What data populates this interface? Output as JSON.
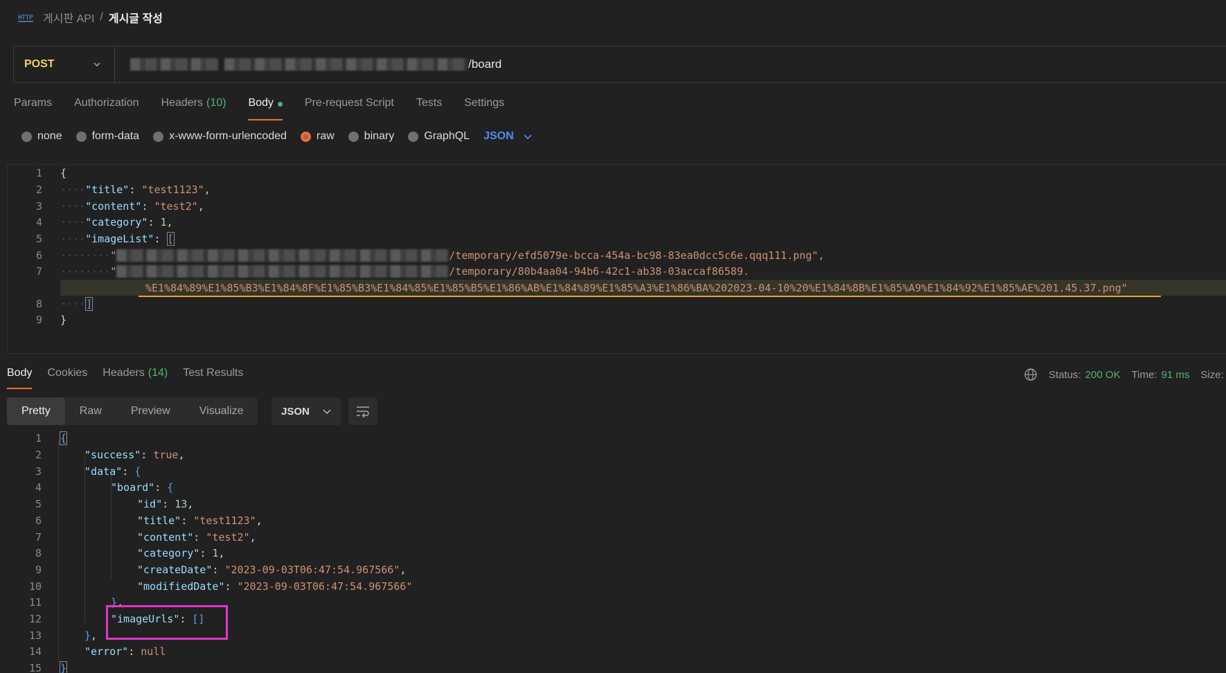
{
  "breadcrumb": {
    "parent": "게시판 API",
    "separator": "/",
    "current": "게시글 작성",
    "icon": "http-icon"
  },
  "request": {
    "method": "POST",
    "url_suffix": "/board"
  },
  "request_tabs": [
    {
      "label": "Params"
    },
    {
      "label": "Authorization"
    },
    {
      "label": "Headers",
      "count": "(10)"
    },
    {
      "label": "Body"
    },
    {
      "label": "Pre-request Script"
    },
    {
      "label": "Tests"
    },
    {
      "label": "Settings"
    }
  ],
  "body_types": [
    "none",
    "form-data",
    "x-www-form-urlencoded",
    "raw",
    "binary",
    "GraphQL"
  ],
  "body_type_selected": "raw",
  "body_format": "JSON",
  "request_body": {
    "line_numbers": [
      "1",
      "2",
      "3",
      "4",
      "5",
      "6",
      "7",
      "8",
      "9"
    ],
    "title_key": "\"title\"",
    "title_val": "\"test1123\"",
    "content_key": "\"content\"",
    "content_val": "\"test2\"",
    "category_key": "\"category\"",
    "category_val": "1",
    "imagelist_key": "\"imageList\"",
    "img1_tail": "/temporary/efd5079e-bcca-454a-bc98-83ea0dcc5c6e.qqq111.png\",",
    "img2_tail": "/temporary/80b4aa04-94b6-42c1-ab38-03accaf86589.",
    "img2_wrap": "%E1%84%89%E1%85%B3%E1%84%8F%E1%85%B3%E1%84%85%E1%85%B5%E1%86%AB%E1%84%89%E1%85%A3%E1%86%BA%202023-04-10%20%E1%84%8B%E1%85%A9%E1%84%92%E1%85%AE%201.45.37.png\""
  },
  "response_tabs": [
    {
      "label": "Body"
    },
    {
      "label": "Cookies"
    },
    {
      "label": "Headers",
      "count": "(14)"
    },
    {
      "label": "Test Results"
    }
  ],
  "response_status": {
    "status_label": "Status:",
    "status_value": "200 OK",
    "time_label": "Time:",
    "time_value": "91 ms",
    "size_label": "Size:"
  },
  "response_views": [
    "Pretty",
    "Raw",
    "Preview",
    "Visualize"
  ],
  "response_format": "JSON",
  "response_body": {
    "line_numbers": [
      "1",
      "2",
      "3",
      "4",
      "5",
      "6",
      "7",
      "8",
      "9",
      "10",
      "11",
      "12",
      "13",
      "14",
      "15"
    ],
    "success_key": "\"success\"",
    "success_val": "true",
    "data_key": "\"data\"",
    "board_key": "\"board\"",
    "id_key": "\"id\"",
    "id_val": "13",
    "title_key": "\"title\"",
    "title_val": "\"test1123\"",
    "content_key": "\"content\"",
    "content_val": "\"test2\"",
    "category_key": "\"category\"",
    "category_val": "1",
    "createdate_key": "\"createDate\"",
    "createdate_val": "\"2023-09-03T06:47:54.967566\"",
    "modifieddate_key": "\"modifiedDate\"",
    "modifieddate_val": "\"2023-09-03T06:47:54.967566\"",
    "imageurls_key": "\"imageUrls\"",
    "imageurls_val": "[]",
    "error_key": "\"error\"",
    "error_val": "null"
  },
  "colors": {
    "accent": "#f26b3a",
    "success": "#4fb571",
    "method": "#f3cf6b",
    "highlight_box": "#e535c9",
    "underline": "#e6a623"
  }
}
